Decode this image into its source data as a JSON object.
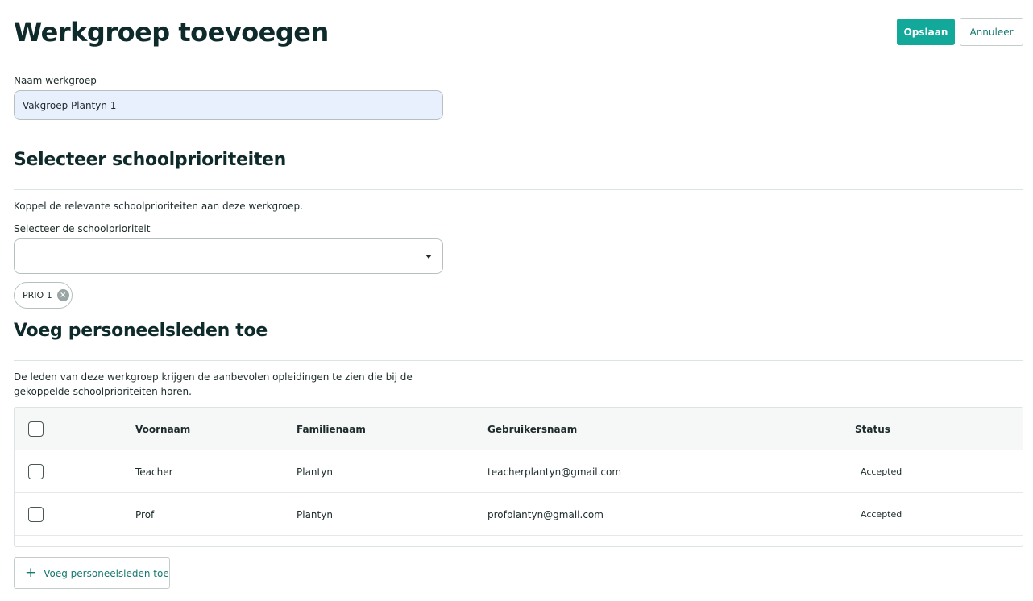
{
  "header": {
    "title": "Werkgroep toevoegen",
    "save_label": "Opslaan",
    "cancel_label": "Annuleer"
  },
  "form": {
    "name_label": "Naam werkgroep",
    "name_value": "Vakgroep Plantyn 1"
  },
  "priorities": {
    "title": "Selecteer schoolprioriteiten",
    "description": "Koppel de relevante schoolprioriteiten aan deze werkgroep.",
    "select_label": "Selecteer de schoolprioriteit",
    "select_value": "",
    "chips": [
      {
        "label": "PRIO 1",
        "icon": "close-circle-icon"
      }
    ]
  },
  "staff": {
    "title": "Voeg personeelsleden toe",
    "description": "De leden van deze werkgroep krijgen de aanbevolen opleidingen te zien die bij de gekoppelde schoolprioriteiten horen.",
    "columns": [
      "Voornaam",
      "Familienaam",
      "Gebruikersnaam",
      "Status"
    ],
    "rows": [
      {
        "first_name": "Teacher",
        "last_name": "Plantyn",
        "username": "teacherplantyn@gmail.com",
        "status": "Accepted"
      },
      {
        "first_name": "Prof",
        "last_name": "Plantyn",
        "username": "profplantyn@gmail.com",
        "status": "Accepted"
      }
    ],
    "add_label": "Voeg personeelsleden toe"
  },
  "colors": {
    "primary": "#12a89a",
    "accent_text": "#16796f",
    "heading": "#0f2a2a"
  }
}
